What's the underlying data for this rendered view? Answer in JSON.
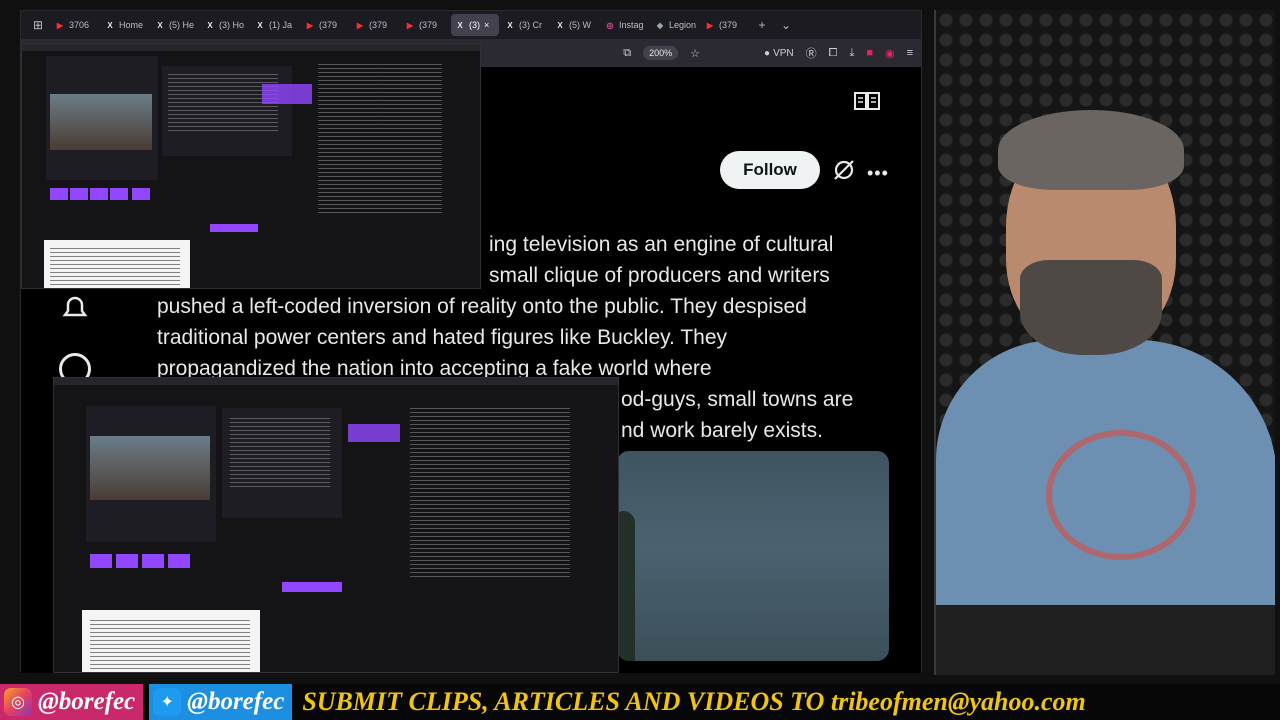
{
  "browser": {
    "tabs": [
      {
        "icon": "youtube-icon",
        "label": "3706"
      },
      {
        "icon": "x-icon",
        "label": "Home"
      },
      {
        "icon": "x-icon",
        "label": "(5) He"
      },
      {
        "icon": "x-icon",
        "label": "(3) Ho"
      },
      {
        "icon": "x-icon",
        "label": "(1) Ja"
      },
      {
        "icon": "youtube-icon",
        "label": "(379"
      },
      {
        "icon": "youtube-icon",
        "label": "(379"
      },
      {
        "icon": "youtube-icon",
        "label": "(379"
      },
      {
        "icon": "x-icon",
        "label": "(3)",
        "active": true
      },
      {
        "icon": "x-icon",
        "label": "(3) Cr"
      },
      {
        "icon": "x-icon",
        "label": "(5) W"
      },
      {
        "icon": "instagram-icon",
        "label": "Instag"
      },
      {
        "icon": "web-icon",
        "label": "Legion"
      },
      {
        "icon": "youtube-icon",
        "label": "(379"
      }
    ],
    "zoom": "200%",
    "vpn_label": "VPN"
  },
  "tweet": {
    "follow_label": "Follow",
    "lines": [
      "ing television as an engine of cultural",
      "small clique of producers and writers",
      "pushed a left-coded inversion of reality onto the public. They despised",
      "traditional power centers and hated figures like Buckley. They",
      "propagandized the nation into accepting a fake world where",
      "od-guys, small towns are",
      "nd work barely exists."
    ]
  },
  "banner": {
    "instagram_handle": "@borefec",
    "twitter_handle": "@borefec",
    "message": "SUBMIT CLIPS, ARTICLES AND VIDEOS TO tribeofmen@yahoo.com"
  },
  "colors": {
    "accent_yellow": "#f1c40f",
    "twitch_purple": "#9146ff",
    "follow_bg": "#eff3f4",
    "page_bg": "#000000"
  }
}
